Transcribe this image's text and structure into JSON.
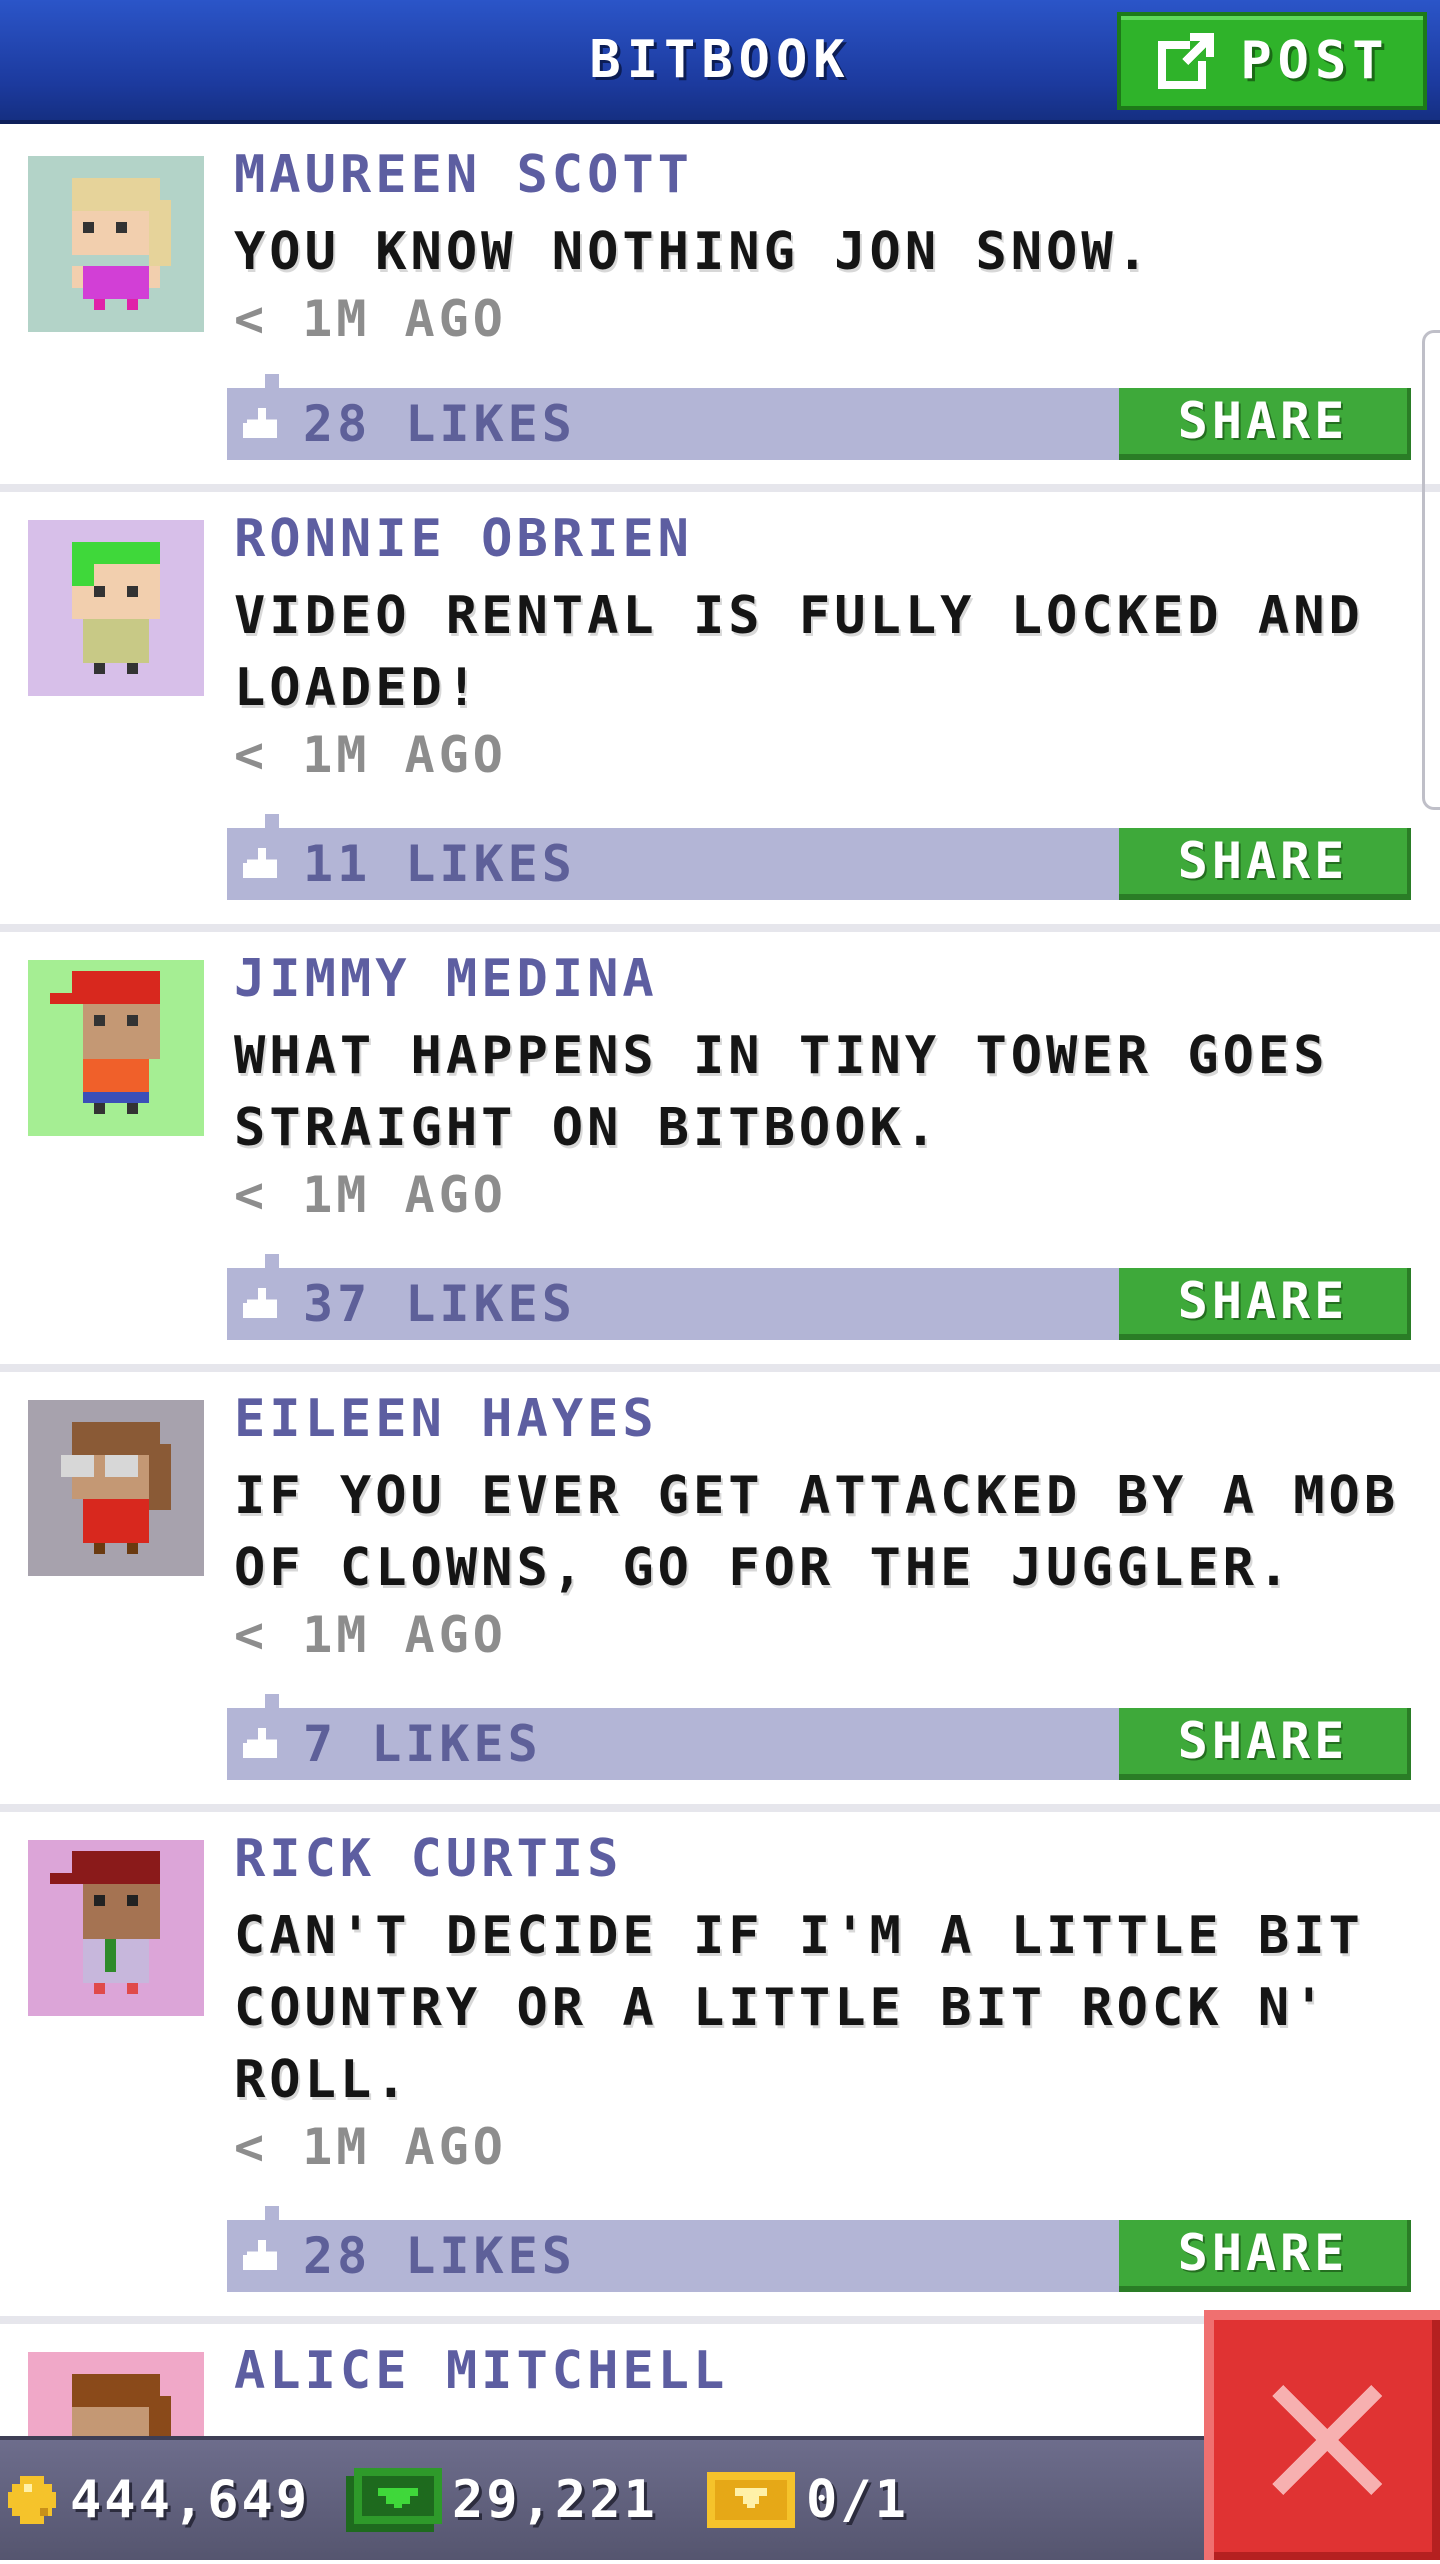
{
  "header": {
    "title": "BITBOOK",
    "post_label": "POST"
  },
  "feed": {
    "share_label": "SHARE",
    "posts": [
      {
        "author": "MAUREEN SCOTT",
        "message": "YOU KNOW NOTHING JON SNOW.",
        "time": "< 1M AGO",
        "likes": "28 LIKES",
        "avatar_bg": "#b3d3c8"
      },
      {
        "author": "RONNIE OBRIEN",
        "message": "VIDEO RENTAL IS FULLY LOCKED AND LOADED!",
        "time": "< 1M AGO",
        "likes": "11 LIKES",
        "avatar_bg": "#d7bfe9"
      },
      {
        "author": "JIMMY MEDINA",
        "message": "WHAT HAPPENS IN TINY TOWER GOES STRAIGHT ON BITBOOK.",
        "time": "< 1M AGO",
        "likes": "37 LIKES",
        "avatar_bg": "#a5ee93"
      },
      {
        "author": "EILEEN HAYES",
        "message": "IF YOU EVER GET ATTACKED BY A MOB OF CLOWNS, GO FOR THE JUGGLER.",
        "time": "< 1M AGO",
        "likes": "7 LIKES",
        "avatar_bg": "#a7a2ad"
      },
      {
        "author": "RICK CURTIS",
        "message": "CAN'T DECIDE IF I'M A LITTLE BIT COUNTRY OR A LITTLE BIT ROCK N' ROLL.",
        "time": "< 1M AGO",
        "likes": "28 LIKES",
        "avatar_bg": "#dca5d8"
      },
      {
        "author": "ALICE MITCHELL",
        "avatar_bg": "#f0a8c8"
      }
    ]
  },
  "status_bar": {
    "coins": "444,649",
    "bux": "29,221",
    "tickets": "0/1"
  },
  "colors": {
    "header_blue": "#1c3a9e",
    "share_green": "#3ea93a",
    "like_bar": "#b3b5d6",
    "close_red": "#e03333"
  },
  "icons": {
    "post": "edit-icon",
    "like": "thumbs-up-icon",
    "coins": "coin-icon",
    "bux": "bux-icon",
    "tickets": "ticket-icon",
    "close": "close-icon"
  }
}
